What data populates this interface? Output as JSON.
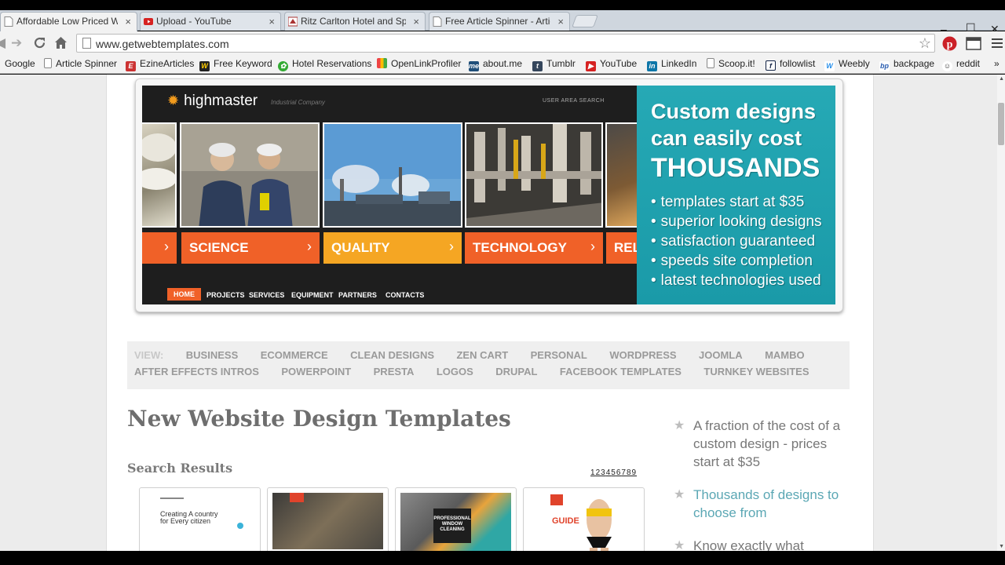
{
  "browser": {
    "tabs": [
      {
        "title": "Affordable Low Priced We",
        "icon": "page-icon"
      },
      {
        "title": "Upload - YouTube",
        "icon": "youtube-icon"
      },
      {
        "title": "Ritz Carlton Hotel and Spa",
        "icon": "hotel-icon"
      },
      {
        "title": "Free Article Spinner - Artic",
        "icon": "page-icon"
      }
    ],
    "tab_close": "×",
    "window_controls": {
      "minimize": "–",
      "maximize": "☐",
      "close": "✕"
    },
    "url": "www.getwebtemplates.com",
    "bookmarks": [
      {
        "label": "Google"
      },
      {
        "label": "Article Spinner"
      },
      {
        "label": "EzineArticles"
      },
      {
        "label": "Free Keyword"
      },
      {
        "label": "Hotel Reservations"
      },
      {
        "label": "OpenLinkProfiler"
      },
      {
        "label": "about.me"
      },
      {
        "label": "Tumblr"
      },
      {
        "label": "YouTube"
      },
      {
        "label": "LinkedIn"
      },
      {
        "label": "Scoop.it!"
      },
      {
        "label": "followlist"
      },
      {
        "label": "Weebly"
      },
      {
        "label": "backpage"
      },
      {
        "label": "reddit"
      }
    ],
    "bookmarks_more": "»"
  },
  "hero": {
    "logo": "highmaster",
    "tagline": "Industrial Company",
    "util_links": "USER AREA   SEARCH",
    "slides": [
      "",
      "SCIENCE",
      "QUALITY",
      "TECHNOLOGY",
      "RELI"
    ],
    "slide_chevron": "›",
    "nav": [
      "HOME",
      "PROJECTS",
      "SERVICES",
      "EQUIPMENT",
      "PARTNERS",
      "CONTACTS"
    ],
    "promo": {
      "line1": "Custom designs",
      "line2": "can easily cost",
      "line3": "THOUSANDS",
      "bullets": [
        "templates start at $35",
        "superior looking designs",
        "satisfaction guaranteed",
        "speeds site completion",
        "latest technologies used"
      ]
    }
  },
  "view": {
    "label": "VIEW:",
    "row1": [
      "BUSINESS",
      "ECOMMERCE",
      "CLEAN DESIGNS",
      "ZEN CART",
      "PERSONAL",
      "WORDPRESS",
      "JOOMLA",
      "MAMBO"
    ],
    "row2": [
      "AFTER EFFECTS INTROS",
      "POWERPOINT",
      "PRESTA",
      "LOGOS",
      "DRUPAL",
      "FACEBOOK TEMPLATES",
      "TURNKEY WEBSITES"
    ]
  },
  "main": {
    "heading": "New Website Design Templates",
    "search_results": "Search Results",
    "pages": [
      "1",
      "2",
      "3",
      "4",
      "5",
      "6",
      "7",
      "8",
      "9"
    ],
    "thumbs": [
      {
        "text": "Creating A country for Every citizen"
      },
      {
        "text": ""
      },
      {
        "text": "PROFESSIONAL WINDOW CLEANING"
      },
      {
        "text": "GUIDE"
      }
    ]
  },
  "sidebar": {
    "items": [
      "A fraction of the cost of a custom design - prices start at $35",
      "Thousands of designs to choose from",
      "Know exactly what"
    ]
  },
  "colors": {
    "accent_orange": "#f06128",
    "accent_yellow": "#f5a623",
    "teal": "#26a9b5"
  }
}
